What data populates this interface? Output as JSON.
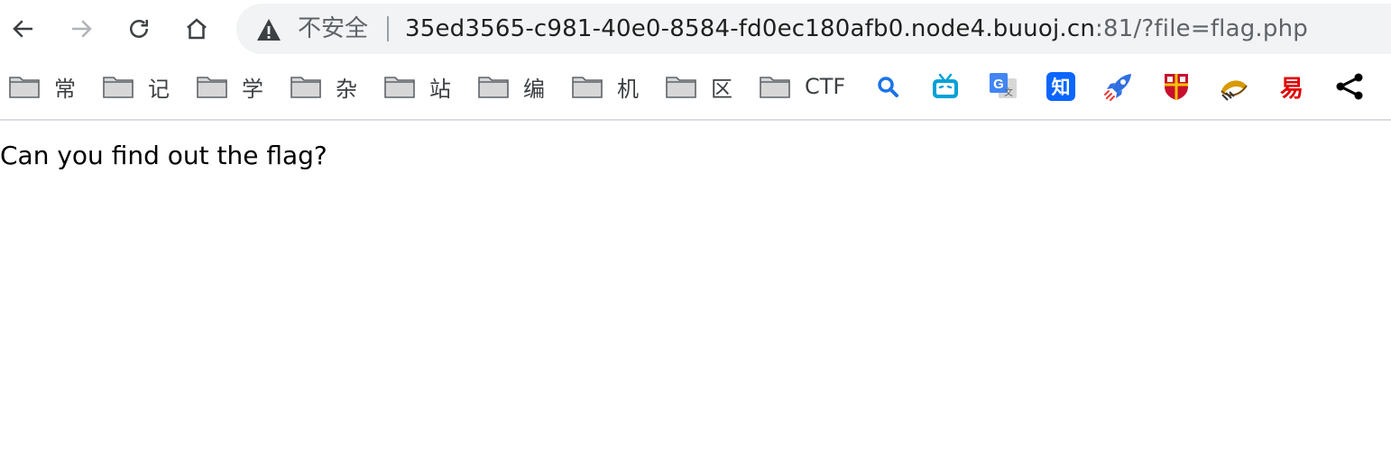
{
  "address_bar": {
    "security_label": "不安全",
    "url_host": "35ed3565-c981-40e0-8584-fd0ec180afb0.node4.buuoj.cn",
    "url_rest": ":81/?file=flag.php"
  },
  "bookmarks": [
    {
      "label": "常"
    },
    {
      "label": "记"
    },
    {
      "label": "学"
    },
    {
      "label": "杂"
    },
    {
      "label": "站"
    },
    {
      "label": "编"
    },
    {
      "label": "机"
    },
    {
      "label": "区"
    },
    {
      "label": "CTF"
    }
  ],
  "extensions": [
    {
      "icon": "search-icon",
      "color": "#1a73e8"
    },
    {
      "icon": "bilibili-icon",
      "color": "#00a1d6"
    },
    {
      "icon": "google-translate-icon",
      "color": "#4285f4"
    },
    {
      "icon": "zhihu-icon",
      "color": "#0a66ff",
      "text": "知"
    },
    {
      "icon": "rocket-icon",
      "color": "#2f6fe0"
    },
    {
      "icon": "shield-crest-icon",
      "color": "#c8102e"
    },
    {
      "icon": "hat-icon",
      "color": "#d89a00"
    },
    {
      "icon": "red-seal-icon",
      "color": "#e00000"
    },
    {
      "icon": "share-icon",
      "color": "#000000"
    }
  ],
  "page": {
    "body_text": "Can you find out the flag?"
  }
}
